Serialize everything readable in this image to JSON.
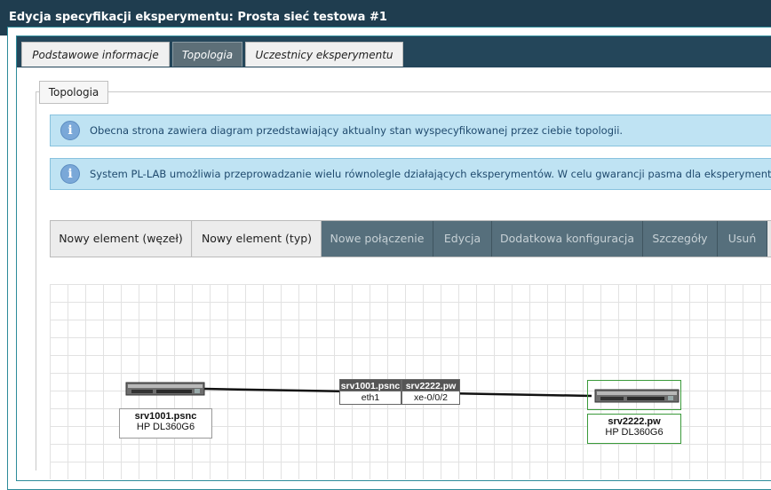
{
  "window": {
    "title": "Edycja specyfikacji eksperymentu: Prosta sieć testowa #1"
  },
  "tabs": [
    {
      "label": "Podstawowe informacje",
      "active": false
    },
    {
      "label": "Topologia",
      "active": true
    },
    {
      "label": "Uczestnicy eksperymentu",
      "active": false
    }
  ],
  "section": {
    "legend": "Topologia"
  },
  "info": [
    {
      "icon": "info-icon",
      "text": "Obecna strona zawiera diagram przedstawiający aktualny stan wyspecyfikowanej przez ciebie topologii."
    },
    {
      "icon": "info-icon",
      "text": "System PL-LAB umożliwia przeprowadzanie wielu równolegle działających eksperymentów. W celu gwarancji pasma dla eksperymentu"
    }
  ],
  "toolbar": [
    {
      "label": "Nowy element (węzeł)",
      "enabled": true
    },
    {
      "label": "Nowy element (typ)",
      "enabled": true
    },
    {
      "label": "Nowe połączenie",
      "enabled": false
    },
    {
      "label": "Edycja",
      "enabled": false
    },
    {
      "label": "Dodatkowa konfiguracja",
      "enabled": false
    },
    {
      "label": "Szczegóły",
      "enabled": false
    },
    {
      "label": "Usuń",
      "enabled": false
    }
  ],
  "topology": {
    "nodes": [
      {
        "name": "srv1001.psnc",
        "type": "HP DL360G6",
        "icon": "server-icon",
        "selected": false
      },
      {
        "name": "srv2222.pw",
        "type": "HP DL360G6",
        "icon": "server-icon",
        "selected": true
      }
    ],
    "link": {
      "endpoints": [
        {
          "host": "srv1001.psnc",
          "iface": "eth1"
        },
        {
          "host": "srv2222.pw",
          "iface": "xe-0/0/2"
        }
      ]
    }
  },
  "colors": {
    "title_bar": "#1f3d4f",
    "accent": "#2e8b9a",
    "info_bg": "#bfe3f3",
    "disabled_btn": "#566f7c",
    "selected_node": "#3a9a3a"
  }
}
